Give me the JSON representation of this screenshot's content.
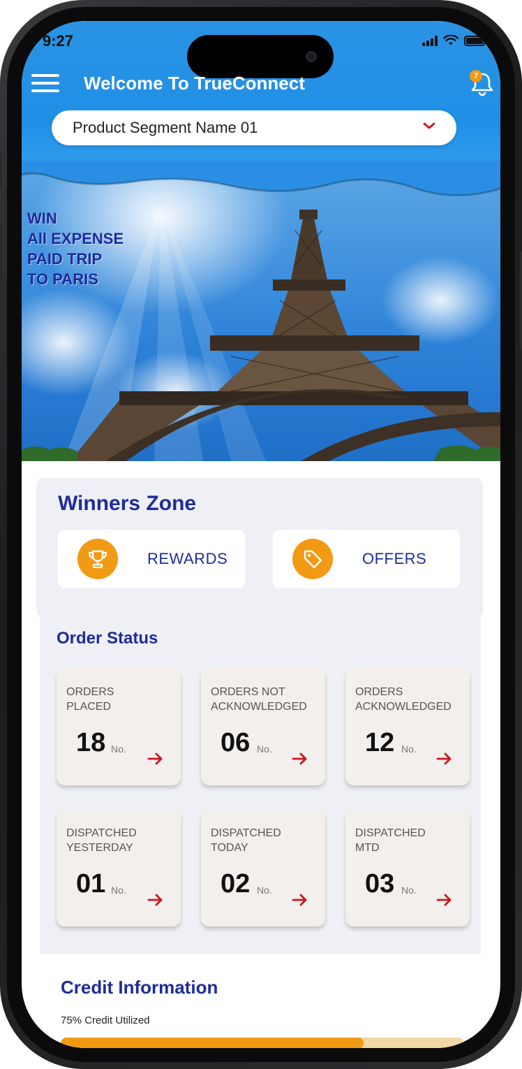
{
  "status_bar": {
    "time": "9:27"
  },
  "header": {
    "title": "Welcome To TrueConnect",
    "notification_count": "7",
    "segment_selected": "Product Segment Name 01"
  },
  "banner": {
    "lines": [
      "WIN",
      "All EXPENSE",
      "PAID TRIP",
      "TO PARIS"
    ]
  },
  "winners_zone": {
    "title": "Winners Zone",
    "buttons": [
      {
        "label": "REWARDS",
        "icon": "trophy-icon"
      },
      {
        "label": "OFFERS",
        "icon": "tag-icon"
      }
    ]
  },
  "order_status": {
    "title": "Order Status",
    "unit": "No.",
    "cards": [
      {
        "label_lines": [
          "ORDERS",
          "PLACED"
        ],
        "value": "18"
      },
      {
        "label_lines": [
          "ORDERS NOT",
          "ACKNOWLEDGED"
        ],
        "value": "06"
      },
      {
        "label_lines": [
          "ORDERS",
          "ACKNOWLEDGED"
        ],
        "value": "12"
      },
      {
        "label_lines": [
          "DISPATCHED",
          "YESTERDAY"
        ],
        "value": "01"
      },
      {
        "label_lines": [
          "DISPATCHED",
          "TODAY"
        ],
        "value": "02"
      },
      {
        "label_lines": [
          "DISPATCHED",
          "MTD"
        ],
        "value": "03"
      }
    ]
  },
  "credit": {
    "title": "Credit Information",
    "utilized_text": "75% Credit Utilized",
    "utilized_fraction": 0.75
  },
  "colors": {
    "primary_blue": "#1f2c9a",
    "header_blue": "#1f8fe6",
    "accent_orange": "#f39a14",
    "arrow_red": "#c8181e"
  }
}
